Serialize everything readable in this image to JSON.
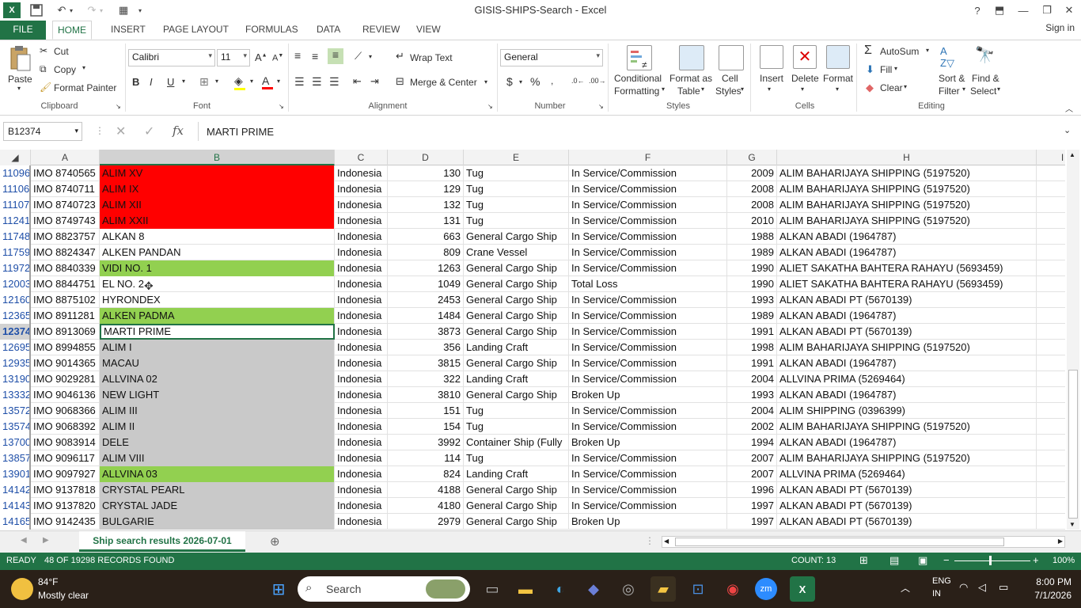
{
  "window": {
    "title": "GISIS-SHIPS-Search - Excel",
    "help": "?",
    "minimize": "—",
    "restore": "❐",
    "close": "✕"
  },
  "tabs": [
    "FILE",
    "HOME",
    "INSERT",
    "PAGE LAYOUT",
    "FORMULAS",
    "DATA",
    "REVIEW",
    "VIEW"
  ],
  "signin": "Sign in",
  "ribbon": {
    "clipboard": {
      "label": "Clipboard",
      "paste": "Paste",
      "cut": "Cut",
      "copy": "Copy",
      "format_painter": "Format Painter"
    },
    "font": {
      "label": "Font",
      "name": "Calibri",
      "size": "11"
    },
    "alignment": {
      "label": "Alignment",
      "wrap": "Wrap Text",
      "merge": "Merge & Center"
    },
    "number": {
      "label": "Number",
      "format": "General"
    },
    "styles": {
      "label": "Styles",
      "conditional": "Conditional",
      "conditional2": "Formatting",
      "format_as": "Format as",
      "table": "Table",
      "cell": "Cell",
      "cell_styles": "Styles"
    },
    "cells": {
      "label": "Cells",
      "insert": "Insert",
      "delete": "Delete",
      "format": "Format"
    },
    "editing": {
      "label": "Editing",
      "autosum": "AutoSum",
      "fill": "Fill",
      "clear": "Clear",
      "sort": "Sort &",
      "filter": "Filter",
      "find": "Find &",
      "select": "Select"
    }
  },
  "formula_bar": {
    "name_box": "B12374",
    "fx": "fx",
    "value": "MARTI PRIME"
  },
  "columns": [
    "A",
    "B",
    "C",
    "D",
    "E",
    "F",
    "G",
    "H",
    "I"
  ],
  "rows": [
    {
      "n": "11096",
      "a": "IMO 8740565",
      "b": "ALIM XV",
      "c": "Indonesia",
      "d": "130",
      "e": "Tug",
      "f": "In Service/Commission",
      "g": "2009",
      "h": "ALIM BAHARIJAYA SHIPPING (5197520)",
      "fill": "red"
    },
    {
      "n": "11106",
      "a": "IMO 8740711",
      "b": "ALIM IX",
      "c": "Indonesia",
      "d": "129",
      "e": "Tug",
      "f": "In Service/Commission",
      "g": "2008",
      "h": "ALIM BAHARIJAYA SHIPPING (5197520)",
      "fill": "red"
    },
    {
      "n": "11107",
      "a": "IMO 8740723",
      "b": "ALIM XII",
      "c": "Indonesia",
      "d": "132",
      "e": "Tug",
      "f": "In Service/Commission",
      "g": "2008",
      "h": "ALIM BAHARIJAYA SHIPPING (5197520)",
      "fill": "red"
    },
    {
      "n": "11241",
      "a": "IMO 8749743",
      "b": "ALIM XXII",
      "c": "Indonesia",
      "d": "131",
      "e": "Tug",
      "f": "In Service/Commission",
      "g": "2010",
      "h": "ALIM BAHARIJAYA SHIPPING (5197520)",
      "fill": "red"
    },
    {
      "n": "11748",
      "a": "IMO 8823757",
      "b": "ALKAN 8",
      "c": "Indonesia",
      "d": "663",
      "e": "General Cargo Ship",
      "f": "In Service/Commission",
      "g": "1988",
      "h": "ALKAN ABADI (1964787)",
      "fill": "none"
    },
    {
      "n": "11759",
      "a": "IMO 8824347",
      "b": "ALKEN PANDAN",
      "c": "Indonesia",
      "d": "809",
      "e": "Crane Vessel",
      "f": "In Service/Commission",
      "g": "1989",
      "h": "ALKAN ABADI (1964787)",
      "fill": "none"
    },
    {
      "n": "11972",
      "a": "IMO 8840339",
      "b": "VIDI NO. 1",
      "c": "Indonesia",
      "d": "1263",
      "e": "General Cargo Ship",
      "f": "In Service/Commission",
      "g": "1990",
      "h": "ALIET SAKATHA BAHTERA RAHAYU (5693459)",
      "fill": "green"
    },
    {
      "n": "12003",
      "a": "IMO 8844751",
      "b": "EL NO. 2",
      "c": "Indonesia",
      "d": "1049",
      "e": "General Cargo Ship",
      "f": "Total Loss",
      "g": "1990",
      "h": "ALIET SAKATHA BAHTERA RAHAYU (5693459)",
      "fill": "none"
    },
    {
      "n": "12160",
      "a": "IMO 8875102",
      "b": "HYRONDEX",
      "c": "Indonesia",
      "d": "2453",
      "e": "General Cargo Ship",
      "f": "In Service/Commission",
      "g": "1993",
      "h": "ALKAN ABADI PT (5670139)",
      "fill": "none"
    },
    {
      "n": "12365",
      "a": "IMO 8911281",
      "b": "ALKEN PADMA",
      "c": "Indonesia",
      "d": "1484",
      "e": "General Cargo Ship",
      "f": "In Service/Commission",
      "g": "1989",
      "h": "ALKAN ABADI (1964787)",
      "fill": "green"
    },
    {
      "n": "12374",
      "a": "IMO 8913069",
      "b": "MARTI PRIME",
      "c": "Indonesia",
      "d": "3873",
      "e": "General Cargo Ship",
      "f": "In Service/Commission",
      "g": "1991",
      "h": "ALKAN ABADI PT (5670139)",
      "fill": "active"
    },
    {
      "n": "12695",
      "a": "IMO 8994855",
      "b": "ALIM I",
      "c": "Indonesia",
      "d": "356",
      "e": "Landing Craft",
      "f": "In Service/Commission",
      "g": "1998",
      "h": "ALIM BAHARIJAYA SHIPPING (5197520)",
      "fill": "gray"
    },
    {
      "n": "12935",
      "a": "IMO 9014365",
      "b": "MACAU",
      "c": "Indonesia",
      "d": "3815",
      "e": "General Cargo Ship",
      "f": "In Service/Commission",
      "g": "1991",
      "h": "ALKAN ABADI (1964787)",
      "fill": "gray"
    },
    {
      "n": "13190",
      "a": "IMO 9029281",
      "b": "ALLVINA 02",
      "c": "Indonesia",
      "d": "322",
      "e": "Landing Craft",
      "f": "In Service/Commission",
      "g": "2004",
      "h": "ALLVINA PRIMA (5269464)",
      "fill": "gray"
    },
    {
      "n": "13332",
      "a": "IMO 9046136",
      "b": "NEW LIGHT",
      "c": "Indonesia",
      "d": "3810",
      "e": "General Cargo Ship",
      "f": "Broken Up",
      "g": "1993",
      "h": "ALKAN ABADI (1964787)",
      "fill": "gray"
    },
    {
      "n": "13572",
      "a": "IMO 9068366",
      "b": "ALIM III",
      "c": "Indonesia",
      "d": "151",
      "e": "Tug",
      "f": "In Service/Commission",
      "g": "2004",
      "h": "ALIM SHIPPING (0396399)",
      "fill": "gray"
    },
    {
      "n": "13574",
      "a": "IMO 9068392",
      "b": "ALIM II",
      "c": "Indonesia",
      "d": "154",
      "e": "Tug",
      "f": "In Service/Commission",
      "g": "2002",
      "h": "ALIM BAHARIJAYA SHIPPING (5197520)",
      "fill": "gray"
    },
    {
      "n": "13700",
      "a": "IMO 9083914",
      "b": "DELE",
      "c": "Indonesia",
      "d": "3992",
      "e": "Container Ship (Fully",
      "f": "Broken Up",
      "g": "1994",
      "h": "ALKAN ABADI (1964787)",
      "fill": "gray"
    },
    {
      "n": "13857",
      "a": "IMO 9096117",
      "b": "ALIM VIII",
      "c": "Indonesia",
      "d": "114",
      "e": "Tug",
      "f": "In Service/Commission",
      "g": "2007",
      "h": "ALIM BAHARIJAYA SHIPPING (5197520)",
      "fill": "gray"
    },
    {
      "n": "13901",
      "a": "IMO 9097927",
      "b": "ALLVINA 03",
      "c": "Indonesia",
      "d": "824",
      "e": "Landing Craft",
      "f": "In Service/Commission",
      "g": "2007",
      "h": "ALLVINA PRIMA (5269464)",
      "fill": "green"
    },
    {
      "n": "14142",
      "a": "IMO 9137818",
      "b": "CRYSTAL PEARL",
      "c": "Indonesia",
      "d": "4188",
      "e": "General Cargo Ship",
      "f": "In Service/Commission",
      "g": "1996",
      "h": "ALKAN ABADI PT (5670139)",
      "fill": "gray"
    },
    {
      "n": "14143",
      "a": "IMO 9137820",
      "b": "CRYSTAL JADE",
      "c": "Indonesia",
      "d": "4180",
      "e": "General Cargo Ship",
      "f": "In Service/Commission",
      "g": "1997",
      "h": "ALKAN ABADI PT (5670139)",
      "fill": "gray"
    },
    {
      "n": "14165",
      "a": "IMO 9142435",
      "b": "BULGARIE",
      "c": "Indonesia",
      "d": "2979",
      "e": "General Cargo Ship",
      "f": "Broken Up",
      "g": "1997",
      "h": "ALKAN ABADI PT (5670139)",
      "fill": "gray"
    }
  ],
  "colors": {
    "red": "#ff0000",
    "green": "#92d050",
    "gray": "#c9c9c9",
    "accent": "#217346"
  },
  "sheet_tab": "Ship search results 2026-07-01",
  "status": {
    "ready": "READY",
    "records": "48 OF 19298 RECORDS FOUND",
    "count": "COUNT: 13",
    "zoom": "100%"
  },
  "taskbar": {
    "weather_temp": "84°F",
    "weather_desc": "Mostly clear",
    "search": "Search",
    "lang1": "ENG",
    "lang2": "IN",
    "time": "8:00 PM",
    "date": "7/1/2026"
  }
}
